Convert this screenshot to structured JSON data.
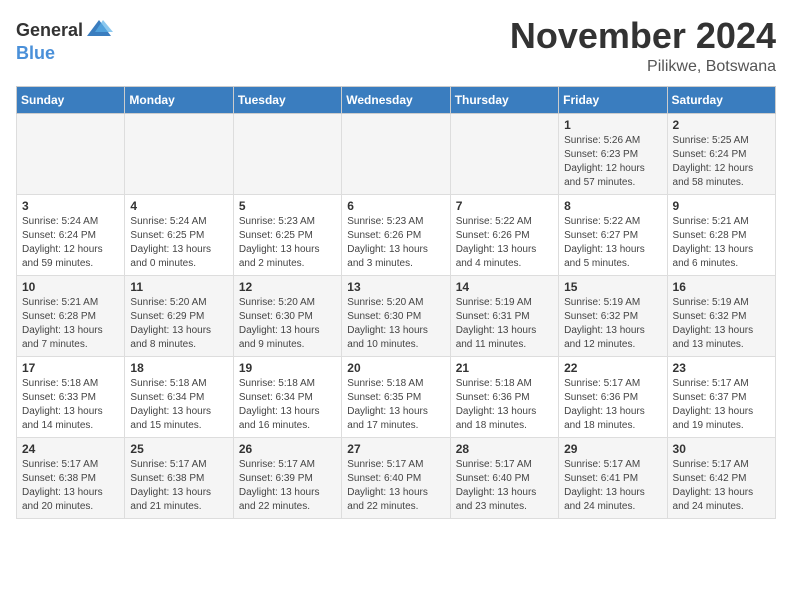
{
  "logo": {
    "general": "General",
    "blue": "Blue"
  },
  "title": "November 2024",
  "location": "Pilikwe, Botswana",
  "days_of_week": [
    "Sunday",
    "Monday",
    "Tuesday",
    "Wednesday",
    "Thursday",
    "Friday",
    "Saturday"
  ],
  "weeks": [
    [
      {
        "day": "",
        "info": ""
      },
      {
        "day": "",
        "info": ""
      },
      {
        "day": "",
        "info": ""
      },
      {
        "day": "",
        "info": ""
      },
      {
        "day": "",
        "info": ""
      },
      {
        "day": "1",
        "info": "Sunrise: 5:26 AM\nSunset: 6:23 PM\nDaylight: 12 hours\nand 57 minutes."
      },
      {
        "day": "2",
        "info": "Sunrise: 5:25 AM\nSunset: 6:24 PM\nDaylight: 12 hours\nand 58 minutes."
      }
    ],
    [
      {
        "day": "3",
        "info": "Sunrise: 5:24 AM\nSunset: 6:24 PM\nDaylight: 12 hours\nand 59 minutes."
      },
      {
        "day": "4",
        "info": "Sunrise: 5:24 AM\nSunset: 6:25 PM\nDaylight: 13 hours\nand 0 minutes."
      },
      {
        "day": "5",
        "info": "Sunrise: 5:23 AM\nSunset: 6:25 PM\nDaylight: 13 hours\nand 2 minutes."
      },
      {
        "day": "6",
        "info": "Sunrise: 5:23 AM\nSunset: 6:26 PM\nDaylight: 13 hours\nand 3 minutes."
      },
      {
        "day": "7",
        "info": "Sunrise: 5:22 AM\nSunset: 6:26 PM\nDaylight: 13 hours\nand 4 minutes."
      },
      {
        "day": "8",
        "info": "Sunrise: 5:22 AM\nSunset: 6:27 PM\nDaylight: 13 hours\nand 5 minutes."
      },
      {
        "day": "9",
        "info": "Sunrise: 5:21 AM\nSunset: 6:28 PM\nDaylight: 13 hours\nand 6 minutes."
      }
    ],
    [
      {
        "day": "10",
        "info": "Sunrise: 5:21 AM\nSunset: 6:28 PM\nDaylight: 13 hours\nand 7 minutes."
      },
      {
        "day": "11",
        "info": "Sunrise: 5:20 AM\nSunset: 6:29 PM\nDaylight: 13 hours\nand 8 minutes."
      },
      {
        "day": "12",
        "info": "Sunrise: 5:20 AM\nSunset: 6:30 PM\nDaylight: 13 hours\nand 9 minutes."
      },
      {
        "day": "13",
        "info": "Sunrise: 5:20 AM\nSunset: 6:30 PM\nDaylight: 13 hours\nand 10 minutes."
      },
      {
        "day": "14",
        "info": "Sunrise: 5:19 AM\nSunset: 6:31 PM\nDaylight: 13 hours\nand 11 minutes."
      },
      {
        "day": "15",
        "info": "Sunrise: 5:19 AM\nSunset: 6:32 PM\nDaylight: 13 hours\nand 12 minutes."
      },
      {
        "day": "16",
        "info": "Sunrise: 5:19 AM\nSunset: 6:32 PM\nDaylight: 13 hours\nand 13 minutes."
      }
    ],
    [
      {
        "day": "17",
        "info": "Sunrise: 5:18 AM\nSunset: 6:33 PM\nDaylight: 13 hours\nand 14 minutes."
      },
      {
        "day": "18",
        "info": "Sunrise: 5:18 AM\nSunset: 6:34 PM\nDaylight: 13 hours\nand 15 minutes."
      },
      {
        "day": "19",
        "info": "Sunrise: 5:18 AM\nSunset: 6:34 PM\nDaylight: 13 hours\nand 16 minutes."
      },
      {
        "day": "20",
        "info": "Sunrise: 5:18 AM\nSunset: 6:35 PM\nDaylight: 13 hours\nand 17 minutes."
      },
      {
        "day": "21",
        "info": "Sunrise: 5:18 AM\nSunset: 6:36 PM\nDaylight: 13 hours\nand 18 minutes."
      },
      {
        "day": "22",
        "info": "Sunrise: 5:17 AM\nSunset: 6:36 PM\nDaylight: 13 hours\nand 18 minutes."
      },
      {
        "day": "23",
        "info": "Sunrise: 5:17 AM\nSunset: 6:37 PM\nDaylight: 13 hours\nand 19 minutes."
      }
    ],
    [
      {
        "day": "24",
        "info": "Sunrise: 5:17 AM\nSunset: 6:38 PM\nDaylight: 13 hours\nand 20 minutes."
      },
      {
        "day": "25",
        "info": "Sunrise: 5:17 AM\nSunset: 6:38 PM\nDaylight: 13 hours\nand 21 minutes."
      },
      {
        "day": "26",
        "info": "Sunrise: 5:17 AM\nSunset: 6:39 PM\nDaylight: 13 hours\nand 22 minutes."
      },
      {
        "day": "27",
        "info": "Sunrise: 5:17 AM\nSunset: 6:40 PM\nDaylight: 13 hours\nand 22 minutes."
      },
      {
        "day": "28",
        "info": "Sunrise: 5:17 AM\nSunset: 6:40 PM\nDaylight: 13 hours\nand 23 minutes."
      },
      {
        "day": "29",
        "info": "Sunrise: 5:17 AM\nSunset: 6:41 PM\nDaylight: 13 hours\nand 24 minutes."
      },
      {
        "day": "30",
        "info": "Sunrise: 5:17 AM\nSunset: 6:42 PM\nDaylight: 13 hours\nand 24 minutes."
      }
    ]
  ]
}
